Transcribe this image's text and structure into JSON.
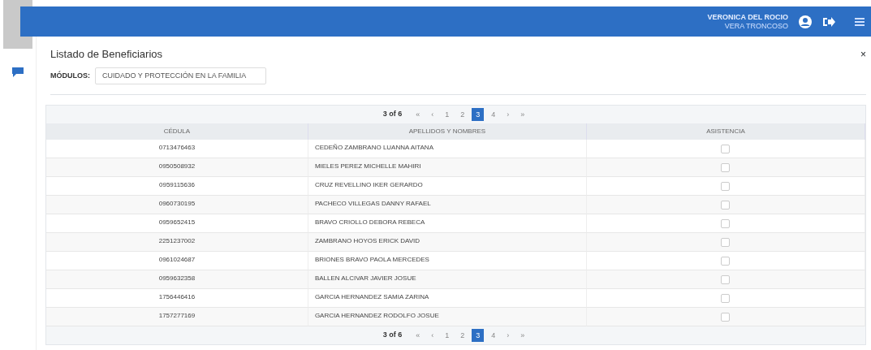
{
  "user": {
    "name": "VERONICA DEL ROCIO",
    "surname": "VERA TRONCOSO"
  },
  "panel": {
    "title": "Listado de Beneficiarios",
    "close": "×"
  },
  "filter": {
    "label": "MÓDULOS:",
    "value": "CUIDADO Y PROTECCIÓN EN LA FAMILIA"
  },
  "pager_top": {
    "summary": "3 of 6",
    "buttons": [
      {
        "label": "«",
        "selected": false
      },
      {
        "label": "‹",
        "selected": false
      },
      {
        "label": "1",
        "selected": false
      },
      {
        "label": "2",
        "selected": false
      },
      {
        "label": "3",
        "selected": true
      },
      {
        "label": "4",
        "selected": false
      },
      {
        "label": "›",
        "selected": false
      },
      {
        "label": "»",
        "selected": false
      }
    ]
  },
  "table": {
    "columns": [
      "CÉDULA",
      "APELLIDOS Y NOMBRES",
      "ASISTENCIA"
    ],
    "rows": [
      {
        "id": "0713476463",
        "name": "CEDEÑO ZAMBRANO LUANNA AITANA",
        "checked": false
      },
      {
        "id": "0950508932",
        "name": "MIELES PEREZ MICHELLE MAHIRI",
        "checked": false
      },
      {
        "id": "0959115636",
        "name": "CRUZ REVELLINO IKER GERARDO",
        "checked": false
      },
      {
        "id": "0960730195",
        "name": "PACHECO VILLEGAS DANNY RAFAEL",
        "checked": false
      },
      {
        "id": "0959652415",
        "name": "BRAVO CRIOLLO DEBORA REBECA",
        "checked": false
      },
      {
        "id": "2251237002",
        "name": "ZAMBRANO HOYOS ERICK DAVID",
        "checked": false
      },
      {
        "id": "0961024687",
        "name": "BRIONES BRAVO PAOLA MERCEDES",
        "checked": false
      },
      {
        "id": "0959632358",
        "name": "BALLEN ALCIVAR JAVIER JOSUE",
        "checked": false
      },
      {
        "id": "1756446416",
        "name": "GARCIA HERNANDEZ SAMIA ZARINA",
        "checked": false
      },
      {
        "id": "1757277169",
        "name": "GARCIA HERNANDEZ RODOLFO JOSUE",
        "checked": false
      }
    ]
  },
  "pager_bottom": {
    "summary": "3 of 6",
    "buttons": [
      {
        "label": "«",
        "selected": false
      },
      {
        "label": "‹",
        "selected": false
      },
      {
        "label": "1",
        "selected": false
      },
      {
        "label": "2",
        "selected": false
      },
      {
        "label": "3",
        "selected": true
      },
      {
        "label": "4",
        "selected": false
      },
      {
        "label": "›",
        "selected": false
      },
      {
        "label": "»",
        "selected": false
      }
    ]
  }
}
